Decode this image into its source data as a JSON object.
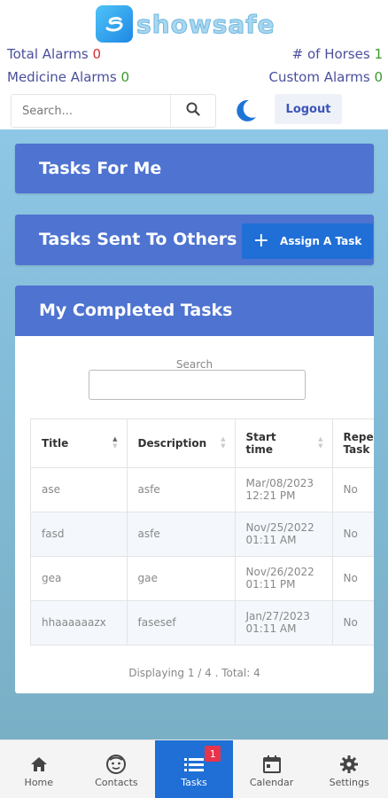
{
  "brand": {
    "name": "showsafe"
  },
  "stats": {
    "total_alarms_label": "Total Alarms",
    "total_alarms_value": "0",
    "horses_label": "# of Horses",
    "horses_value": "1",
    "medicine_alarms_label": "Medicine Alarms",
    "medicine_alarms_value": "0",
    "custom_alarms_label": "Custom Alarms",
    "custom_alarms_value": "0"
  },
  "search": {
    "placeholder": "Search...",
    "icon": "search-icon"
  },
  "theme_toggle": {
    "icon": "moon-icon"
  },
  "logout_label": "Logout",
  "panels": {
    "tasks_for_me": "Tasks For Me",
    "tasks_sent": "Tasks Sent To Others",
    "assign_label": "Assign A Task",
    "completed": "My Completed Tasks"
  },
  "table": {
    "search_label": "Search",
    "columns": [
      "Title",
      "Description",
      "Start time",
      "Repeat Task"
    ],
    "rows": [
      {
        "title": "ase",
        "description": "asfe",
        "start": "Mar/08/2023 12:21 PM",
        "repeat": "No"
      },
      {
        "title": "fasd",
        "description": "asfe",
        "start": "Nov/25/2022 01:11 AM",
        "repeat": "No"
      },
      {
        "title": "gea",
        "description": "gae",
        "start": "Nov/26/2022 01:11 PM",
        "repeat": "No"
      },
      {
        "title": "hhaaaaaazx",
        "description": "fasesef",
        "start": "Jan/27/2023 01:11 AM",
        "repeat": "No"
      }
    ],
    "footer": "Displaying 1 / 4 . Total: 4"
  },
  "nav": {
    "items": [
      {
        "label": "Home",
        "icon": "home-icon"
      },
      {
        "label": "Contacts",
        "icon": "contacts-icon"
      },
      {
        "label": "Tasks",
        "icon": "tasks-icon",
        "badge": "1"
      },
      {
        "label": "Calendar",
        "icon": "calendar-icon"
      },
      {
        "label": "Settings",
        "icon": "gear-icon"
      }
    ]
  },
  "colors": {
    "accent": "#1f6fd6",
    "panel": "#4e73d0",
    "stat_label": "#4a4f9c",
    "value_green": "#3b9a2e",
    "value_red": "#d62e2e",
    "badge": "#e7344a"
  }
}
